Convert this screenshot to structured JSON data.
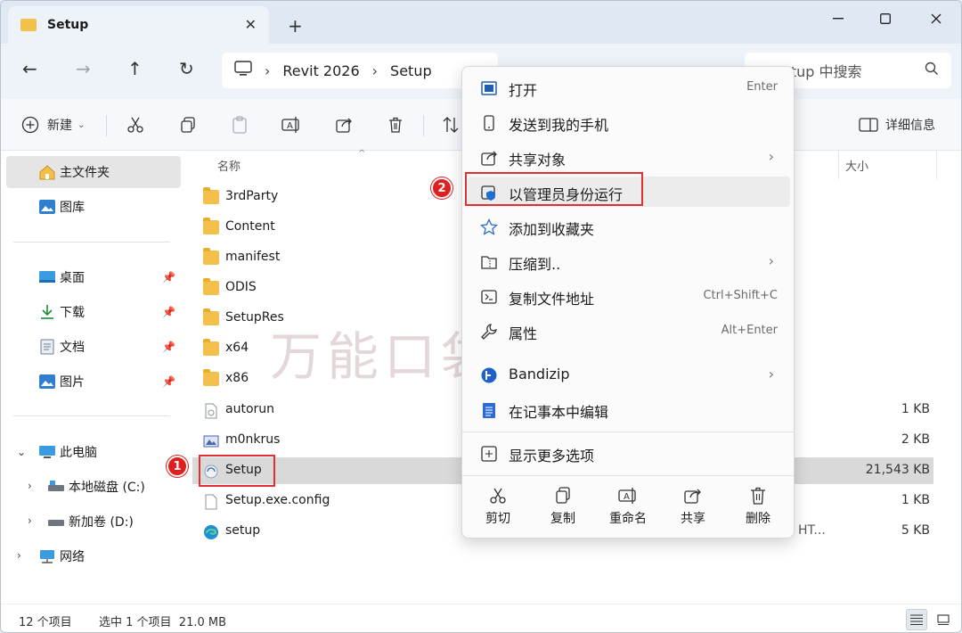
{
  "window": {
    "tab_title": "Setup",
    "controls": {
      "minimize": "minimize",
      "maximize": "maximize",
      "close": "close"
    }
  },
  "nav": {
    "breadcrumb": [
      "Revit 2026",
      "Setup"
    ],
    "search_placeholder": "etup 中搜索"
  },
  "commandbar": {
    "new_label": "新建",
    "details_label": "详细信息"
  },
  "sidebar": {
    "home": "主文件夹",
    "gallery": "图库",
    "quick_access": [
      "桌面",
      "下载",
      "文档",
      "图片"
    ],
    "this_pc": "此电脑",
    "drives": [
      "本地磁盘 (C:)",
      "新加卷 (D:)"
    ],
    "network": "网络"
  },
  "filelist": {
    "col_name": "名称",
    "col_size": "大小",
    "rows": [
      {
        "name": "3rdParty",
        "type": "folder",
        "size": "",
        "kind": ""
      },
      {
        "name": "Content",
        "type": "folder",
        "size": "",
        "kind": ""
      },
      {
        "name": "manifest",
        "type": "folder",
        "size": "",
        "kind": ""
      },
      {
        "name": "ODIS",
        "type": "folder",
        "size": "",
        "kind": ""
      },
      {
        "name": "SetupRes",
        "type": "folder",
        "size": "",
        "kind": ""
      },
      {
        "name": "x64",
        "type": "folder",
        "size": "",
        "kind": ""
      },
      {
        "name": "x86",
        "type": "folder",
        "size": "",
        "kind": ""
      },
      {
        "name": "autorun",
        "type": "file",
        "size": "1 KB",
        "kind": ""
      },
      {
        "name": "m0nkrus",
        "type": "image",
        "size": "2 KB",
        "kind": ""
      },
      {
        "name": "Setup",
        "type": "exe",
        "size": "21,543 KB",
        "kind": ""
      },
      {
        "name": "Setup.exe.config",
        "type": "file",
        "size": "1 KB",
        "kind": ""
      },
      {
        "name": "setup",
        "type": "edge",
        "size": "5 KB",
        "kind": "HT..."
      }
    ]
  },
  "status": {
    "count": "12 个项目",
    "selected": "选中 1 个项目  21.0 MB"
  },
  "context_menu": {
    "items": [
      {
        "label": "打开",
        "shortcut": "Enter",
        "arrow": false
      },
      {
        "label": "发送到我的手机",
        "shortcut": "",
        "arrow": false
      },
      {
        "label": "共享对象",
        "shortcut": "",
        "arrow": true
      },
      {
        "label": "以管理员身份运行",
        "shortcut": "",
        "arrow": false
      },
      {
        "label": "添加到收藏夹",
        "shortcut": "",
        "arrow": false
      },
      {
        "label": "压缩到..",
        "shortcut": "",
        "arrow": true
      },
      {
        "label": "复制文件地址",
        "shortcut": "Ctrl+Shift+C",
        "arrow": false
      },
      {
        "label": "属性",
        "shortcut": "Alt+Enter",
        "arrow": false
      },
      {
        "label": "Bandizip",
        "shortcut": "",
        "arrow": true
      },
      {
        "label": "在记事本中编辑",
        "shortcut": "",
        "arrow": false
      },
      {
        "label": "显示更多选项",
        "shortcut": "",
        "arrow": false
      }
    ],
    "actions": [
      "剪切",
      "复制",
      "重命名",
      "共享",
      "删除"
    ]
  },
  "annotations": {
    "badge1": "1",
    "badge2": "2"
  },
  "watermark": "万能口袋资源社",
  "colors": {
    "accent": "#0067c0",
    "folder": "#f3c14b",
    "highlight": "#e03030"
  }
}
